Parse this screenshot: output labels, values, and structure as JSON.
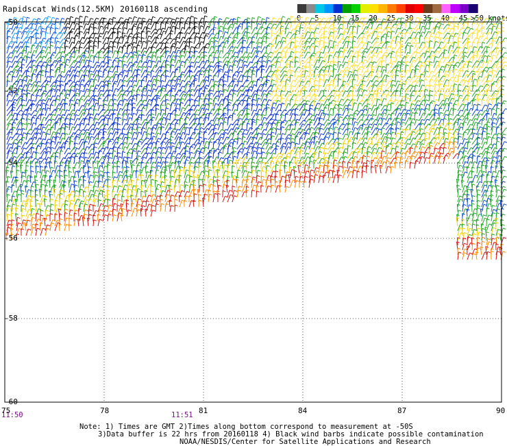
{
  "title": "Rapidscat Winds(12.5KM) 20160118 ascending",
  "legend": {
    "ticks": [
      "0",
      "5",
      "10",
      "15",
      "20",
      "25",
      "30",
      "35",
      "40",
      "45",
      ">50 knots"
    ],
    "colors": [
      "#3a3a3a",
      "#8a8a8a",
      "#00c8e6",
      "#0096ff",
      "#0030d0",
      "#00a000",
      "#00d000",
      "#e0f000",
      "#ffe000",
      "#ffb400",
      "#ff7800",
      "#ff4000",
      "#e00000",
      "#ff0000",
      "#6a3a1a",
      "#a06a40",
      "#ff60ff",
      "#c000ff",
      "#7a00c8",
      "#1a0070"
    ]
  },
  "map": {
    "lat_labels": [
      "-50",
      "-52",
      "-54",
      "-56",
      "-58",
      "-60"
    ],
    "lon_labels": [
      "75",
      "78",
      "81",
      "84",
      "87",
      "90"
    ]
  },
  "times": [
    "11:50",
    "11:51"
  ],
  "notes": [
    "Note: 1) Times are GMT 2)Times along bottom correspond to measurement at -50S",
    "3)Data buffer is 22 hrs from 20160118 4) Black wind barbs indicate possible contamination",
    "NOAA/NESDIS/Center for Satellite Applications and Research"
  ]
}
